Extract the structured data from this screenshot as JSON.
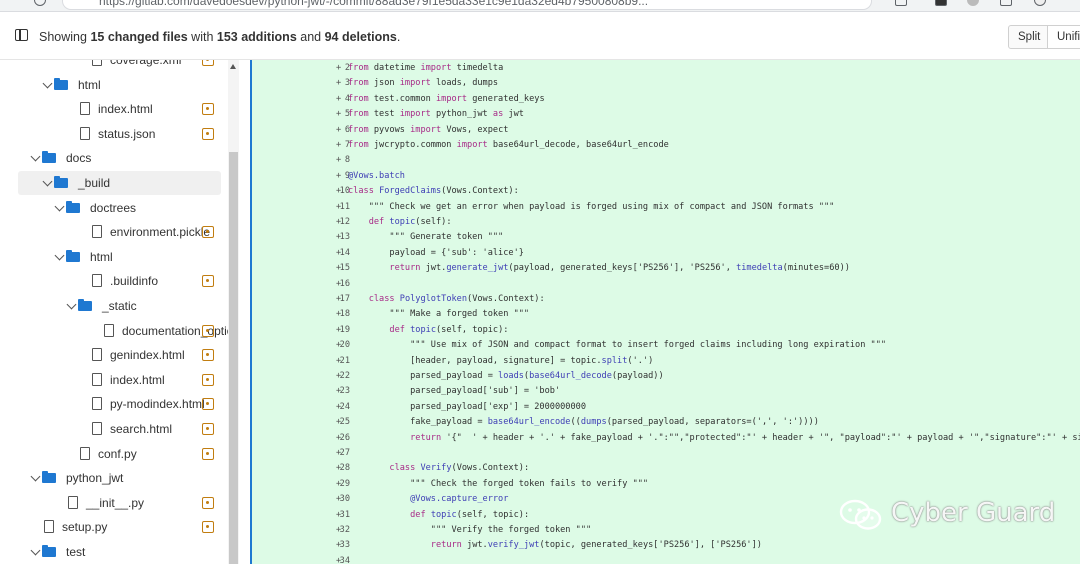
{
  "browser": {
    "url": "https://gitlab.com/davedoesdev/python-jwt/-/commit/88ad3e79f1e5da33e1c9e1da32ed4b79500808b9..."
  },
  "header": {
    "summary_prefix": "Showing ",
    "changed_files": "15 changed files",
    "with": " with ",
    "additions": "153 additions",
    "and": " and ",
    "deletions": "94 deletions",
    "period": ".",
    "split_label": "Split",
    "unified_label": "Unified"
  },
  "tree": [
    {
      "label": "coverage.xml",
      "type": "file",
      "depth": 3,
      "modified": true
    },
    {
      "label": "html",
      "type": "folder",
      "depth": 1,
      "open": true
    },
    {
      "label": "index.html",
      "type": "file",
      "depth": 2,
      "modified": true
    },
    {
      "label": "status.json",
      "type": "file",
      "depth": 2,
      "modified": true
    },
    {
      "label": "docs",
      "type": "folder",
      "depth": 0,
      "open": true
    },
    {
      "label": "_build",
      "type": "folder",
      "depth": 1,
      "open": true,
      "selected": true
    },
    {
      "label": "doctrees",
      "type": "folder",
      "depth": 2,
      "open": true
    },
    {
      "label": "environment.pickle",
      "type": "file",
      "depth": 3,
      "modified": true
    },
    {
      "label": "html",
      "type": "folder",
      "depth": 2,
      "open": true
    },
    {
      "label": ".buildinfo",
      "type": "file",
      "depth": 3,
      "modified": true
    },
    {
      "label": "_static",
      "type": "folder",
      "depth": 3,
      "open": true
    },
    {
      "label": "documentation_optio...",
      "type": "file",
      "depth": 4,
      "modified": true
    },
    {
      "label": "genindex.html",
      "type": "file",
      "depth": 3,
      "modified": true
    },
    {
      "label": "index.html",
      "type": "file",
      "depth": 3,
      "modified": true
    },
    {
      "label": "py-modindex.html",
      "type": "file",
      "depth": 3,
      "modified": true
    },
    {
      "label": "search.html",
      "type": "file",
      "depth": 3,
      "modified": true
    },
    {
      "label": "conf.py",
      "type": "file",
      "depth": 2,
      "modified": true
    },
    {
      "label": "python_jwt",
      "type": "folder",
      "depth": 0,
      "open": true
    },
    {
      "label": "__init__.py",
      "type": "file",
      "depth": 1,
      "modified": true
    },
    {
      "label": "setup.py",
      "type": "file",
      "depth": -1,
      "modified": true
    },
    {
      "label": "test",
      "type": "folder",
      "depth": 0,
      "open": true
    }
  ],
  "diff": [
    {
      "num": "2",
      "sign": "+",
      "code": "from datetime import timedelta"
    },
    {
      "num": "3",
      "sign": "+",
      "code": "from json import loads, dumps"
    },
    {
      "num": "4",
      "sign": "+",
      "code": "from test.common import generated_keys"
    },
    {
      "num": "5",
      "sign": "+",
      "code": "from test import python_jwt as jwt"
    },
    {
      "num": "6",
      "sign": "+",
      "code": "from pyvows import Vows, expect"
    },
    {
      "num": "7",
      "sign": "+",
      "code": "from jwcrypto.common import base64url_decode, base64url_encode"
    },
    {
      "num": "8",
      "sign": "+",
      "code": ""
    },
    {
      "num": "9",
      "sign": "+",
      "code": "@Vows.batch"
    },
    {
      "num": "10",
      "sign": "+",
      "code": "class ForgedClaims(Vows.Context):"
    },
    {
      "num": "11",
      "sign": "+",
      "code": "    \"\"\" Check we get an error when payload is forged using mix of compact and JSON formats \"\"\""
    },
    {
      "num": "12",
      "sign": "+",
      "code": "    def topic(self):"
    },
    {
      "num": "13",
      "sign": "+",
      "code": "        \"\"\" Generate token \"\"\""
    },
    {
      "num": "14",
      "sign": "+",
      "code": "        payload = {'sub': 'alice'}"
    },
    {
      "num": "15",
      "sign": "+",
      "code": "        return jwt.generate_jwt(payload, generated_keys['PS256'], 'PS256', timedelta(minutes=60))"
    },
    {
      "num": "16",
      "sign": "+",
      "code": ""
    },
    {
      "num": "17",
      "sign": "+",
      "code": "    class PolyglotToken(Vows.Context):"
    },
    {
      "num": "18",
      "sign": "+",
      "code": "        \"\"\" Make a forged token \"\"\""
    },
    {
      "num": "19",
      "sign": "+",
      "code": "        def topic(self, topic):"
    },
    {
      "num": "20",
      "sign": "+",
      "code": "            \"\"\" Use mix of JSON and compact format to insert forged claims including long expiration \"\"\""
    },
    {
      "num": "21",
      "sign": "+",
      "code": "            [header, payload, signature] = topic.split('.')"
    },
    {
      "num": "22",
      "sign": "+",
      "code": "            parsed_payload = loads(base64url_decode(payload))"
    },
    {
      "num": "23",
      "sign": "+",
      "code": "            parsed_payload['sub'] = 'bob'"
    },
    {
      "num": "24",
      "sign": "+",
      "code": "            parsed_payload['exp'] = 2000000000"
    },
    {
      "num": "25",
      "sign": "+",
      "code": "            fake_payload = base64url_encode((dumps(parsed_payload, separators=(',', ':'))))"
    },
    {
      "num": "26",
      "sign": "+",
      "code": "            return '{\"  ' + header + '.' + fake_payload + '.\":\"\",\"protected\":\"' + header + '\", \"payload\":\"' + payload + '\",\"signature\":\"' + signa"
    },
    {
      "num": "27",
      "sign": "+",
      "code": ""
    },
    {
      "num": "28",
      "sign": "+",
      "code": "        class Verify(Vows.Context):"
    },
    {
      "num": "29",
      "sign": "+",
      "code": "            \"\"\" Check the forged token fails to verify \"\"\""
    },
    {
      "num": "30",
      "sign": "+",
      "code": "            @Vows.capture_error"
    },
    {
      "num": "31",
      "sign": "+",
      "code": "            def topic(self, topic):"
    },
    {
      "num": "32",
      "sign": "+",
      "code": "                \"\"\" Verify the forged token \"\"\""
    },
    {
      "num": "33",
      "sign": "+",
      "code": "                return jwt.verify_jwt(topic, generated_keys['PS256'], ['PS256'])"
    },
    {
      "num": "34",
      "sign": "+",
      "code": ""
    }
  ],
  "watermark": "Cyber Guard"
}
